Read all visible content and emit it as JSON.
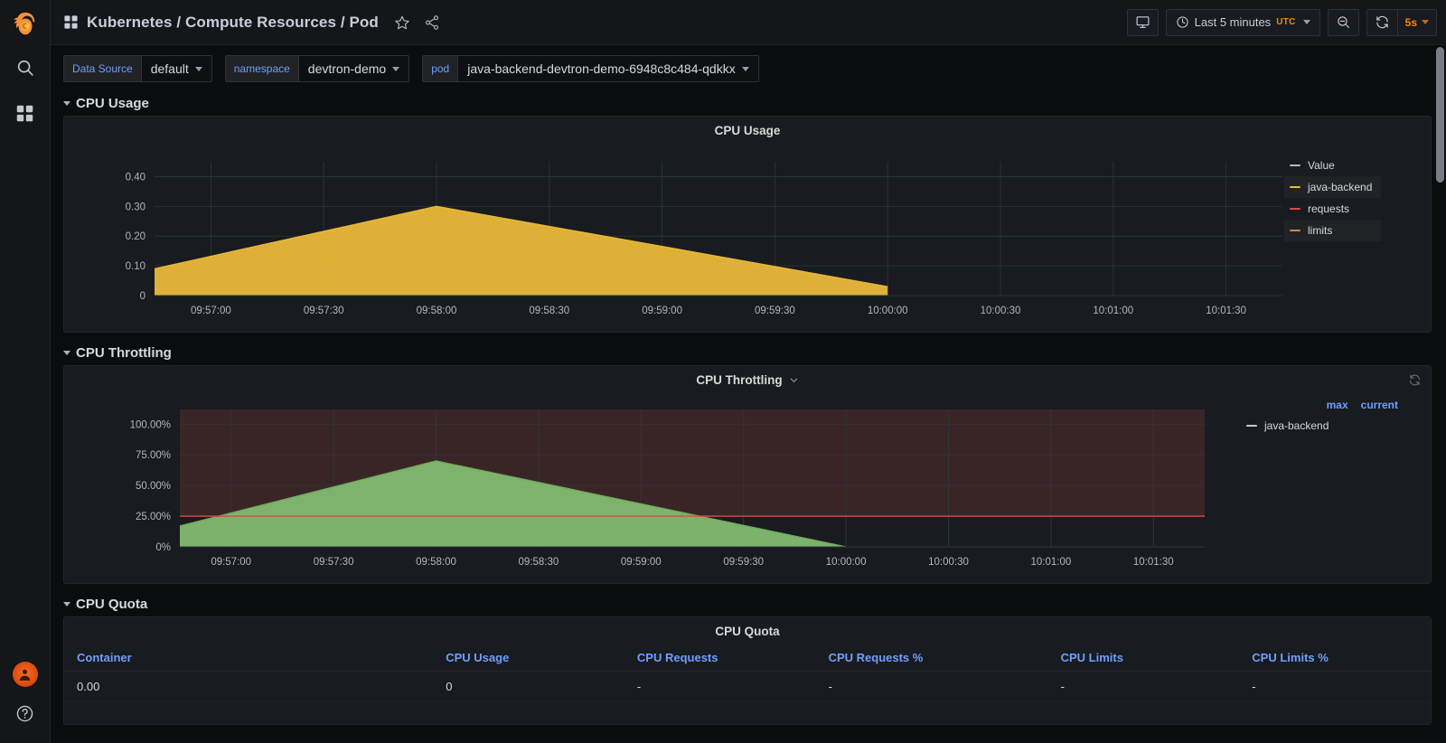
{
  "sidebar": {
    "logo_name": "grafana-logo",
    "items": [
      {
        "name": "search-icon",
        "label": "Search"
      },
      {
        "name": "dashboards-icon",
        "label": "Dashboards"
      }
    ],
    "bottom": [
      {
        "name": "user-avatar-icon",
        "label": "User"
      },
      {
        "name": "help-icon",
        "label": "Help"
      }
    ]
  },
  "header": {
    "title": "Kubernetes / Compute Resources / Pod",
    "dashboard_icon": "dashboard-grid-icon",
    "star_icon": "star-icon",
    "share_icon": "share-icon",
    "tv_button": "tv-mode-icon",
    "time_range": "Last 5 minutes",
    "time_zone": "UTC",
    "zoom_out_icon": "zoom-out-icon",
    "refresh_icon": "refresh-icon",
    "refresh_interval": "5s"
  },
  "variables": [
    {
      "label": "Data Source",
      "value": "default"
    },
    {
      "label": "namespace",
      "value": "devtron-demo"
    },
    {
      "label": "pod",
      "value": "java-backend-devtron-demo-6948c8c484-qdkkx"
    }
  ],
  "rows": [
    {
      "title": "CPU Usage"
    },
    {
      "title": "CPU Throttling"
    },
    {
      "title": "CPU Quota"
    }
  ],
  "panels": {
    "cpu_usage": {
      "title": "CPU Usage",
      "legend_header": "Value",
      "legend": [
        {
          "label": "Value",
          "color": "#b8b9ba",
          "header": true
        },
        {
          "label": "java-backend",
          "color": "#eab839",
          "highlight": true
        },
        {
          "label": "requests",
          "color": "#e0464a",
          "highlight": false
        },
        {
          "label": "limits",
          "color": "#d98a2b",
          "highlight": true
        }
      ]
    },
    "cpu_throttling": {
      "title": "CPU Throttling",
      "menu_icon": "chevron-down-icon",
      "corner_icon": "refresh-spinner-icon",
      "legend_stats": [
        "max",
        "current"
      ],
      "legend": [
        {
          "label": "java-backend",
          "color": "#c8c9ca"
        }
      ]
    },
    "cpu_quota": {
      "title": "CPU Quota",
      "columns": [
        "Container",
        "CPU Usage",
        "CPU Requests",
        "CPU Requests %",
        "CPU Limits",
        "CPU Limits %"
      ],
      "rows": [
        [
          "0.00",
          "0",
          "-",
          "-",
          "-",
          "-"
        ]
      ]
    }
  },
  "chart_data": [
    {
      "type": "area",
      "title": "CPU Usage",
      "xlabel": "",
      "ylabel": "",
      "ylim": [
        0,
        0.45
      ],
      "yticks": [
        "0",
        "0.10",
        "0.20",
        "0.30",
        "0.40"
      ],
      "ytick_values": [
        0,
        0.1,
        0.2,
        0.3,
        0.4
      ],
      "xticks": [
        "09:57:00",
        "09:57:30",
        "09:58:00",
        "09:58:30",
        "09:59:00",
        "09:59:30",
        "10:00:00",
        "10:00:30",
        "10:01:00",
        "10:01:30"
      ],
      "grid": true,
      "legend_position": "right",
      "series": [
        {
          "name": "java-backend",
          "color": "#eab839",
          "fill": "#eab839",
          "x": [
            "09:56:45",
            "09:58:00",
            "10:00:00"
          ],
          "values": [
            0.09,
            0.3,
            0.03
          ]
        }
      ]
    },
    {
      "type": "area",
      "title": "CPU Throttling",
      "xlabel": "",
      "ylabel": "",
      "ylim": [
        0,
        112
      ],
      "yticks": [
        "0%",
        "25.00%",
        "50.00%",
        "75.00%",
        "100.00%"
      ],
      "ytick_values": [
        0,
        25,
        50,
        75,
        100
      ],
      "xticks": [
        "09:57:00",
        "09:57:30",
        "09:58:00",
        "09:58:30",
        "09:59:00",
        "09:59:30",
        "10:00:00",
        "10:00:30",
        "10:01:00",
        "10:01:30"
      ],
      "grid": true,
      "legend_position": "right",
      "threshold": {
        "value": 25,
        "color": "#e0464a",
        "region_color": "#3a2526",
        "label": "25%"
      },
      "series": [
        {
          "name": "java-backend",
          "color": "#70ad5a",
          "fill": "#86bf73",
          "x": [
            "09:56:45",
            "09:58:00",
            "10:00:00"
          ],
          "values": [
            17,
            70,
            0
          ]
        }
      ]
    }
  ]
}
